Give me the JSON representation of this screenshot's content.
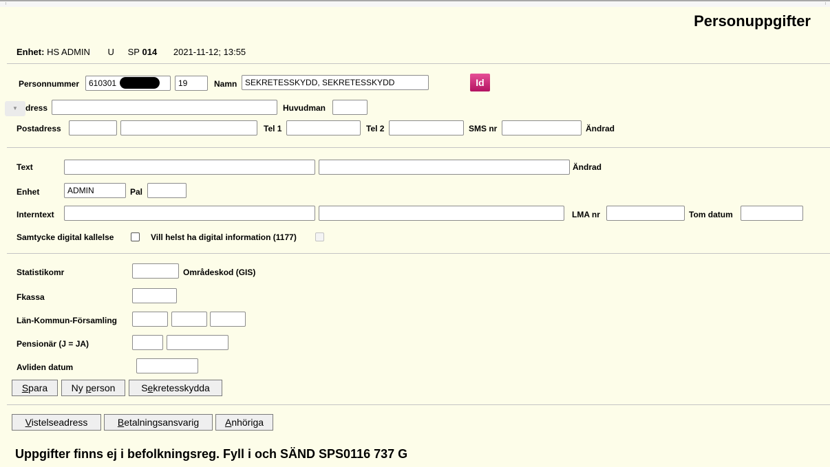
{
  "header": {
    "title": "Personuppgifter",
    "enhet_label": "Enhet:",
    "enhet_value": "HS ADMIN",
    "u": "U",
    "sp_label": "SP",
    "sp_value": "014",
    "datetime": "2021-11-12; 13:55"
  },
  "person": {
    "personnummer_label": "Personnummer",
    "personnummer_value": "610301",
    "century_value": "19",
    "namn_label": "Namn",
    "namn_value": "SEKRETESSKYDD, SEKRETESSKYDD",
    "id_icon_text": "Id",
    "adress_label": "dress",
    "huvudman_label": "Huvudman",
    "postadress_label": "Postadress",
    "tel1_label": "Tel 1",
    "tel2_label": "Tel 2",
    "sms_label": "SMS nr",
    "andrad_label": "Ändrad"
  },
  "text_section": {
    "text_label": "Text",
    "andrad_label": "Ändrad",
    "enhet_label": "Enhet",
    "enhet_value": "ADMIN",
    "pal_label": "Pal",
    "interntext_label": "Interntext",
    "lma_label": "LMA nr",
    "tom_datum_label": "Tom datum",
    "samtycke_label": "Samtycke digital kallelse",
    "vill_helst_label": "Vill helst ha digital information (1177)"
  },
  "stats": {
    "statistikomr_label": "Statistikomr",
    "omradeskod_label": "Områdeskod (GIS)",
    "fkassa_label": "Fkassa",
    "lkf_label": "Län-Kommun-Församling",
    "pensionar_label": "Pensionär (J = JA)",
    "avliden_label": "Avliden datum"
  },
  "buttons": {
    "spara_u": "S",
    "spara_rest": "para",
    "ny_a": "Ny ",
    "ny_u": "p",
    "ny_rest": "erson",
    "sek_a": "S",
    "sek_u": "e",
    "sek_rest": "kretesskydda",
    "vis_u": "V",
    "vis_rest": "istelseadress",
    "bet_u": "B",
    "bet_rest": "etalningsansvarig",
    "anh_u": "A",
    "anh_rest": "nhöriga"
  },
  "footer": {
    "message": "Uppgifter finns ej i befolkningsreg. Fyll i och SÄND SPS0116 737 G"
  }
}
